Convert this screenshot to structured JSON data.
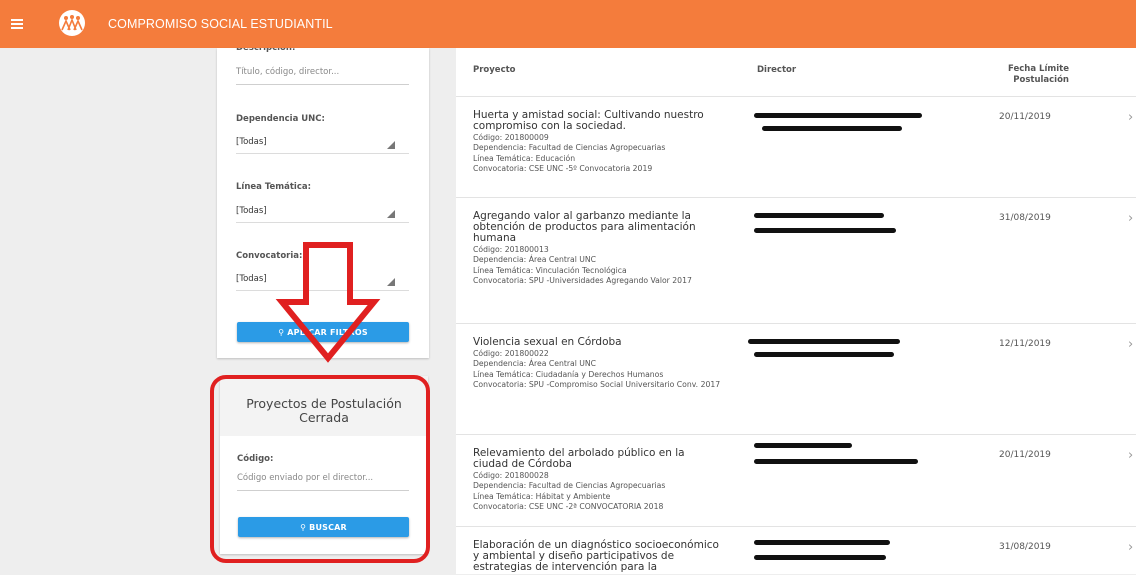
{
  "header": {
    "title": "COMPROMISO SOCIAL ESTUDIANTIL",
    "menu_icon": "hamburger-icon",
    "logo_icon": "people-logo-icon",
    "accent_color": "#f47c3c"
  },
  "filters": {
    "description_label": "Descripción:",
    "description_placeholder": "Título, código, director...",
    "dependencia_label": "Dependencia UNC:",
    "dependencia_value": "[Todas]",
    "linea_label": "Línea Temática:",
    "linea_value": "[Todas]",
    "convocatoria_label": "Convocatoria:",
    "convocatoria_value": "[Todas]",
    "apply_label": "APLICAR FILTROS",
    "apply_icon": "search-icon"
  },
  "closed": {
    "title": "Proyectos de Postulación Cerrada",
    "code_label": "Código:",
    "code_placeholder": "Código enviado por el director...",
    "search_label": "BUSCAR",
    "search_icon": "search-icon"
  },
  "table": {
    "headers": {
      "project": "Proyecto",
      "director": "Director",
      "deadline_line1": "Fecha Límite",
      "deadline_line2": "Postulación"
    },
    "rows": [
      {
        "title": "Huerta y amistad social: Cultivando nuestro compromiso con la sociedad.",
        "code": "Código: 201800009",
        "dependencia": "Dependencia: Facultad de Ciencias Agropecuarias",
        "linea": "Línea Temática: Educación",
        "convocatoria": "Convocatoria: CSE UNC -5º Convocatoria 2019",
        "date": "20/11/2019"
      },
      {
        "title": "Agregando valor al garbanzo mediante la obtención de productos para alimentación humana",
        "code": "Código: 201800013",
        "dependencia": "Dependencia: Área Central UNC",
        "linea": "Línea Temática: Vinculación Tecnológica",
        "convocatoria": "Convocatoria: SPU -Universidades Agregando Valor 2017",
        "date": "31/08/2019"
      },
      {
        "title": "Violencia sexual en Córdoba",
        "code": "Código: 201800022",
        "dependencia": "Dependencia: Área Central UNC",
        "linea": "Línea Temática: Ciudadanía y Derechos Humanos",
        "convocatoria": "Convocatoria: SPU -Compromiso Social Universitario Conv. 2017",
        "date": "12/11/2019"
      },
      {
        "title": "Relevamiento del arbolado público en la ciudad de Córdoba",
        "code": "Código: 201800028",
        "dependencia": "Dependencia: Facultad de Ciencias Agropecuarias",
        "linea": "Línea Temática: Hábitat y Ambiente",
        "convocatoria": "Convocatoria: CSE UNC -2ª CONVOCATORIA 2018",
        "date": "20/11/2019"
      },
      {
        "title": "Elaboración de un diagnóstico socioeconómico y ambiental y diseño participativos de estrategias de intervención para la",
        "date": "31/08/2019"
      }
    ],
    "chevron": "›"
  },
  "annotation_color": "#e02020"
}
